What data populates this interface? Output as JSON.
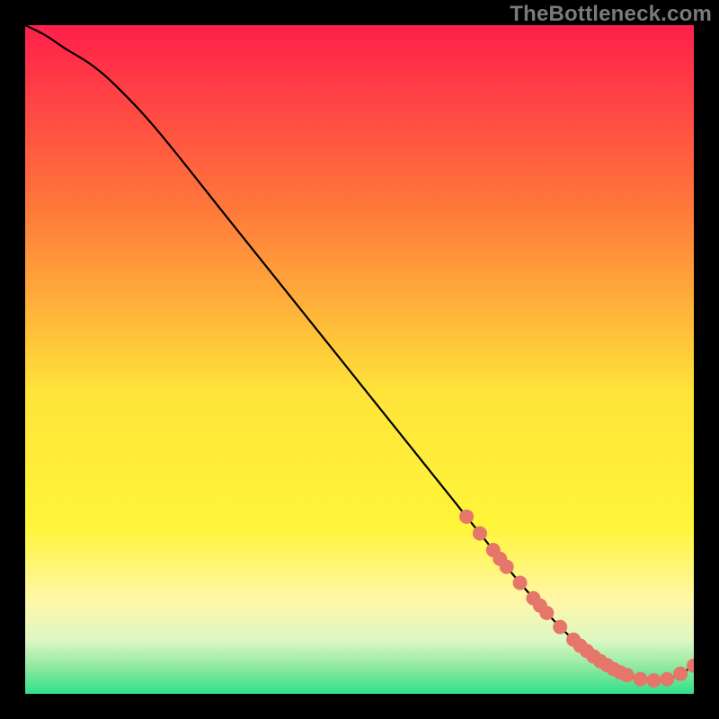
{
  "watermark": "TheBottleneck.com",
  "colors": {
    "background": "#000000",
    "curve": "#000000",
    "marker_fill": "#e6766a",
    "marker_stroke": "#d35c50",
    "gradient_top": "#ff1f4b",
    "gradient_mid_upper": "#ff8a3a",
    "gradient_mid": "#ffe43a",
    "gradient_mid_lower": "#fff7a8",
    "gradient_band": "#ddf7c4",
    "gradient_bottom": "#2fe08a"
  },
  "chart_data": {
    "type": "line",
    "title": "",
    "xlabel": "",
    "ylabel": "",
    "xlim": [
      0,
      100
    ],
    "ylim": [
      0,
      100
    ],
    "grid": false,
    "legend": false,
    "series": [
      {
        "name": "bottleneck-curve",
        "x": [
          0,
          3,
          6,
          10,
          14,
          20,
          30,
          40,
          50,
          60,
          66,
          70,
          72,
          74,
          76,
          78,
          80,
          82,
          84,
          86,
          88,
          90,
          92,
          94,
          96,
          98,
          100
        ],
        "y": [
          100,
          98.5,
          96.5,
          94,
          90.5,
          84,
          71.5,
          59,
          46.5,
          34,
          26.5,
          21.5,
          19,
          16.6,
          14.3,
          12.1,
          10.0,
          8.1,
          6.4,
          4.9,
          3.7,
          2.8,
          2.2,
          2.0,
          2.2,
          3.0,
          4.2
        ]
      }
    ],
    "markers": [
      {
        "x": 66,
        "y": 26.5
      },
      {
        "x": 68,
        "y": 24.0
      },
      {
        "x": 70,
        "y": 21.5
      },
      {
        "x": 71,
        "y": 20.2
      },
      {
        "x": 72,
        "y": 19.0
      },
      {
        "x": 74,
        "y": 16.6
      },
      {
        "x": 76,
        "y": 14.3
      },
      {
        "x": 77,
        "y": 13.2
      },
      {
        "x": 78,
        "y": 12.1
      },
      {
        "x": 80,
        "y": 10.0
      },
      {
        "x": 82,
        "y": 8.1
      },
      {
        "x": 83,
        "y": 7.2
      },
      {
        "x": 84,
        "y": 6.4
      },
      {
        "x": 85,
        "y": 5.6
      },
      {
        "x": 86,
        "y": 4.9
      },
      {
        "x": 87,
        "y": 4.3
      },
      {
        "x": 88,
        "y": 3.7
      },
      {
        "x": 89,
        "y": 3.2
      },
      {
        "x": 90,
        "y": 2.8
      },
      {
        "x": 92,
        "y": 2.2
      },
      {
        "x": 94,
        "y": 2.0
      },
      {
        "x": 96,
        "y": 2.2
      },
      {
        "x": 98,
        "y": 3.0
      },
      {
        "x": 100,
        "y": 4.2
      }
    ],
    "annotations": []
  }
}
